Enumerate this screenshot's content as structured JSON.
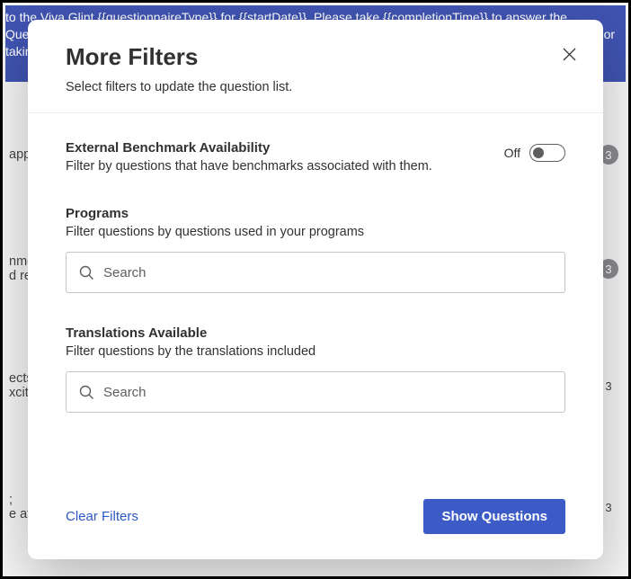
{
  "header_banner": "to the Viva Glint {{questionnaireType}} for {{startDate}}. Please take {{completionTime}} to answer the Questions. We appreciate your responses. We will be sending communications with updates. {{senderNam or taking action.",
  "bg_rows": [
    {
      "text": "app",
      "badge": "3"
    },
    {
      "text": "nme\nd rec",
      "badge": "3"
    },
    {
      "text": "ects\nxcite",
      "badge": "3"
    },
    {
      "text": ";\ne at",
      "badge": "3"
    }
  ],
  "modal": {
    "title": "More Filters",
    "subtitle": "Select filters to update the question list.",
    "close_label": "Close",
    "sections": {
      "benchmark": {
        "title": "External Benchmark Availability",
        "desc": "Filter by questions that have benchmarks associated with them.",
        "toggle_state": "Off"
      },
      "programs": {
        "title": "Programs",
        "desc": "Filter questions by questions used in your programs",
        "search_placeholder": "Search"
      },
      "translations": {
        "title": "Translations Available",
        "desc": "Filter questions by the translations included",
        "search_placeholder": "Search"
      }
    },
    "footer": {
      "clear": "Clear Filters",
      "show": "Show Questions"
    }
  }
}
